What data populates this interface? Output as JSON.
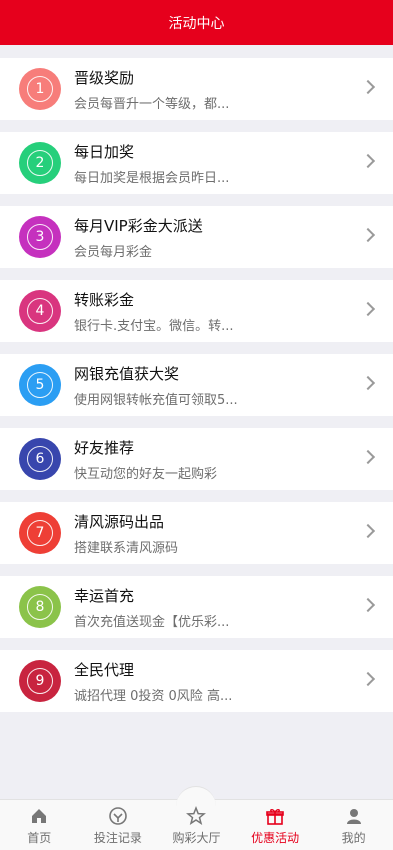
{
  "header": {
    "title": "活动中心"
  },
  "activities": [
    {
      "num": "1",
      "title": "晋级奖励",
      "desc": "会员每晋升一个等级，都...",
      "color": "#f77d7a"
    },
    {
      "num": "2",
      "title": "每日加奖",
      "desc": "每日加奖是根据会员昨日...",
      "color": "#26cf7b"
    },
    {
      "num": "3",
      "title": "每月VIP彩金大派送",
      "desc": "会员每月彩金",
      "color": "#c531be"
    },
    {
      "num": "4",
      "title": "转账彩金",
      "desc": "银行卡.支付宝。微信。转...",
      "color": "#d9357f"
    },
    {
      "num": "5",
      "title": "网银充值获大奖",
      "desc": "使用网银转帐充值可领取5...",
      "color": "#2b9ef3"
    },
    {
      "num": "6",
      "title": "好友推荐",
      "desc": "快互动您的好友一起购彩",
      "color": "#3846ad"
    },
    {
      "num": "7",
      "title": "清风源码出品",
      "desc": "搭建联系清风源码",
      "color": "#ee3f36"
    },
    {
      "num": "8",
      "title": "幸运首充",
      "desc": "首次充值送现金【优乐彩...",
      "color": "#8bc34a"
    },
    {
      "num": "9",
      "title": "全民代理",
      "desc": "诚招代理 0投资 0风险 高...",
      "color": "#c8243f"
    }
  ],
  "tabbar": {
    "items": [
      {
        "label": "首页",
        "icon": "home-icon"
      },
      {
        "label": "投注记录",
        "icon": "bet-record-icon"
      },
      {
        "label": "购彩大厅",
        "icon": "star-icon"
      },
      {
        "label": "优惠活动",
        "icon": "gift-icon",
        "active": true
      },
      {
        "label": "我的",
        "icon": "person-icon"
      }
    ],
    "active_color": "#e6001c"
  }
}
